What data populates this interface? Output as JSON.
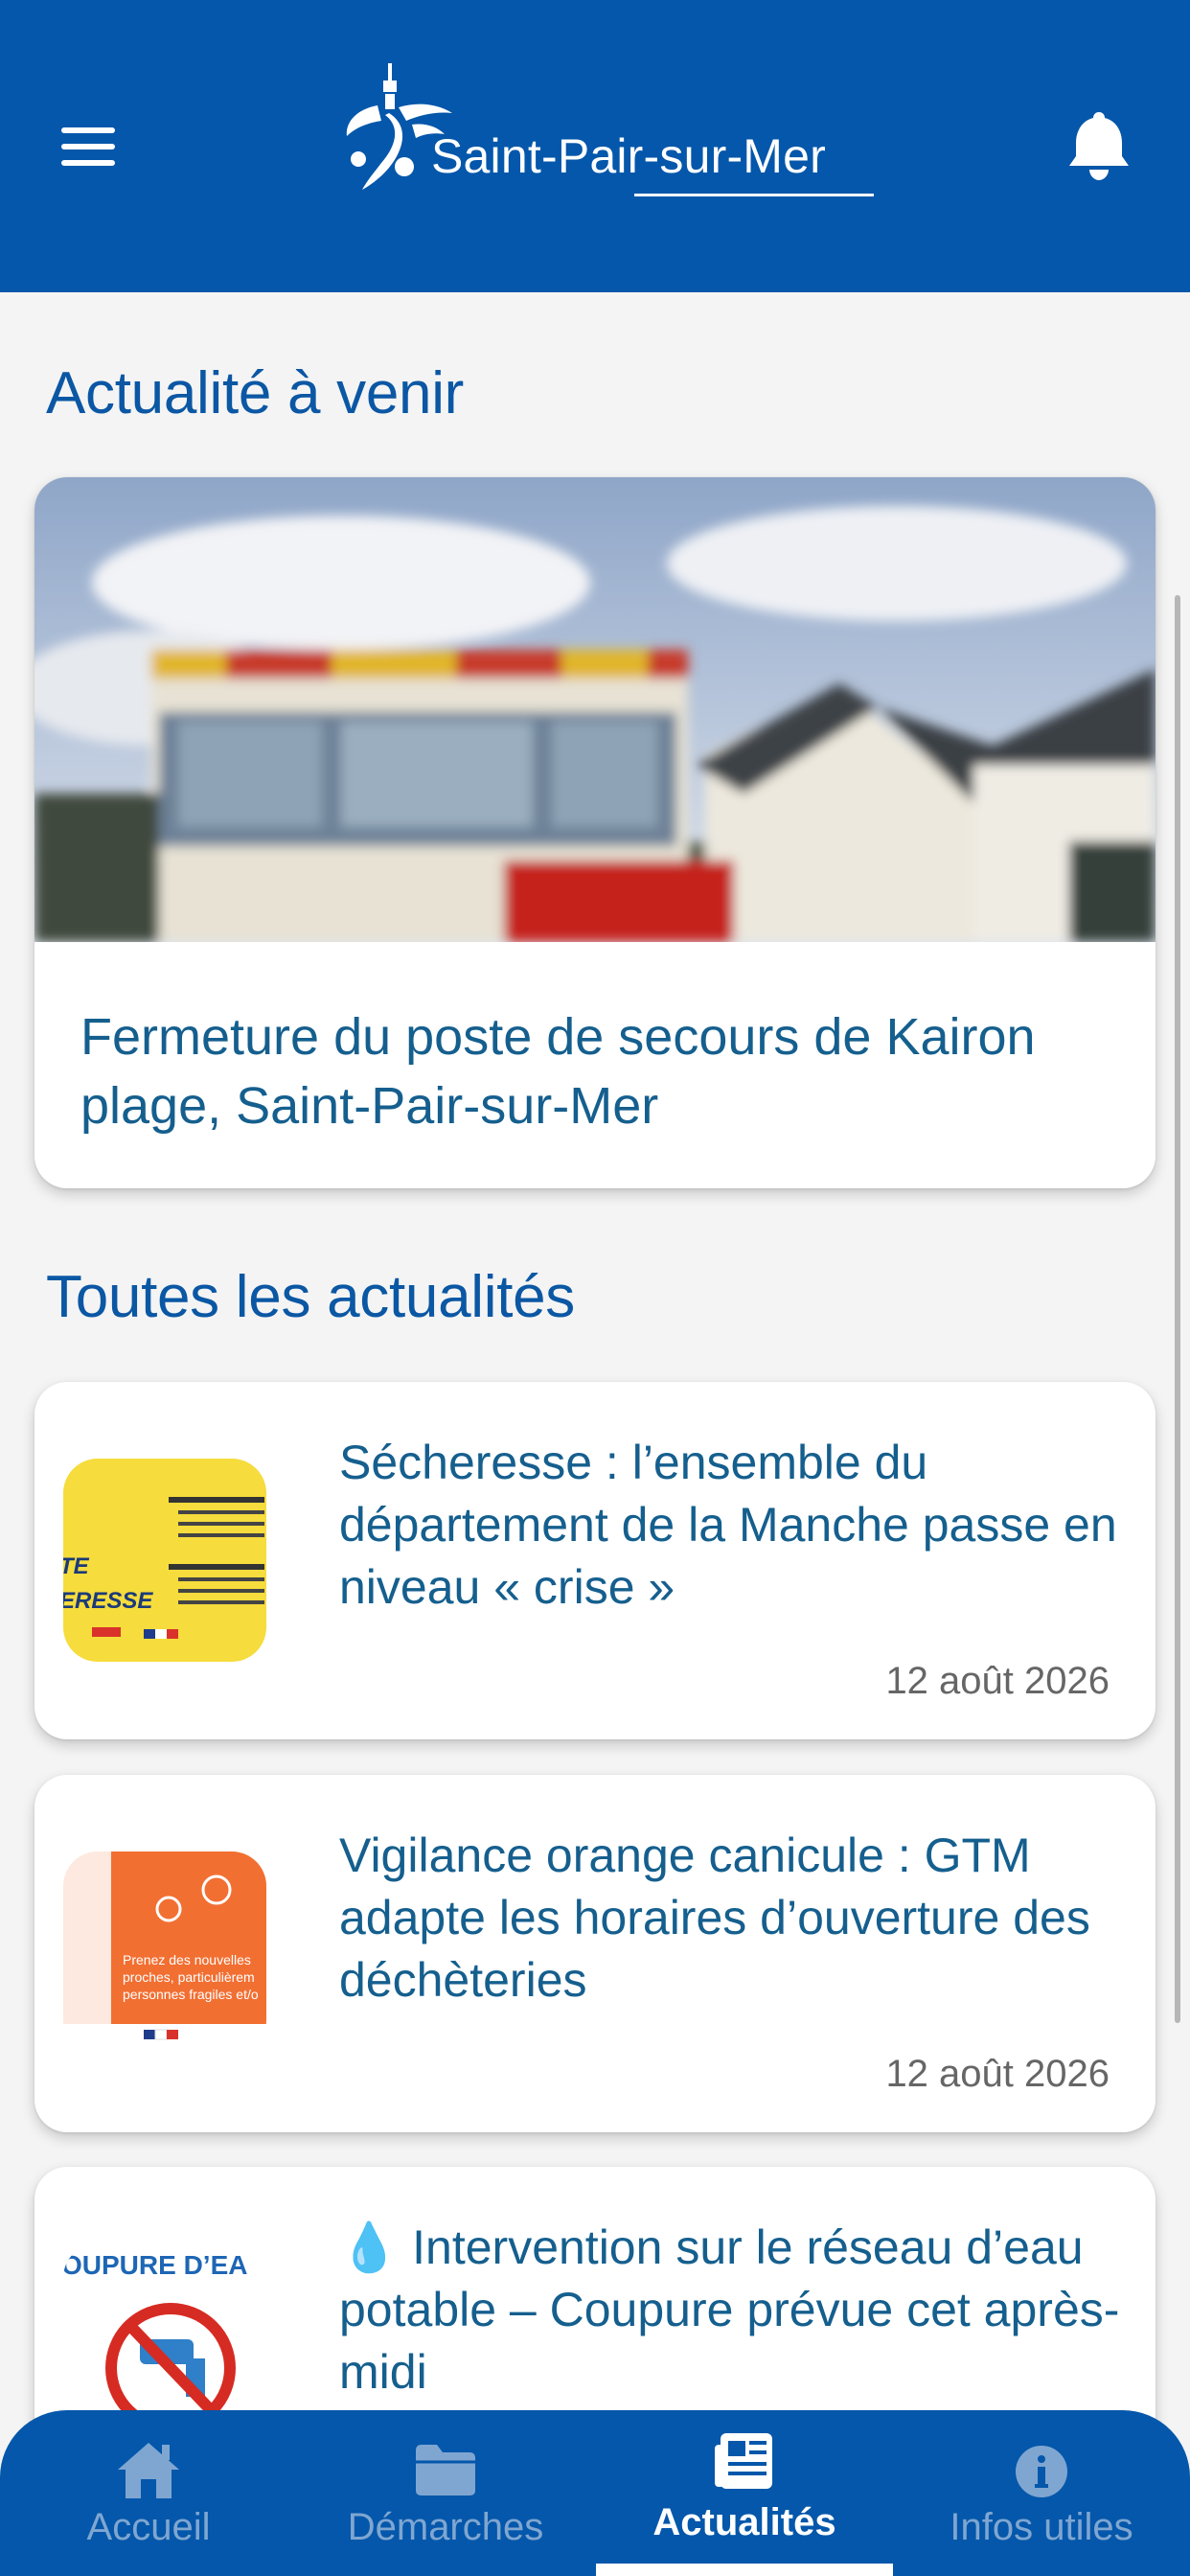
{
  "header": {
    "app_name": "Saint-Pair-sur-Mer",
    "menu_icon": "hamburger-menu-icon",
    "notification_icon": "bell-icon"
  },
  "upcoming": {
    "section_title": "Actualité à venir",
    "card_title": "Fermeture du poste de secours de Kairon plage, Saint-Pair-sur-Mer"
  },
  "all_news": {
    "section_title": "Toutes les actualités",
    "items": [
      {
        "title": "Sécheresse : l’ensemble du département de la Manche passe en niveau « crise »",
        "date": "12 août 2026",
        "thumb_lines": [
          "TE",
          "ERESSE"
        ]
      },
      {
        "title": "Vigilance orange canicule : GTM adapte les horaires d’ouverture des déchèteries",
        "date": "12 août 2026",
        "thumb_lines": [
          "Prenez des nouvelles",
          "proches, particulièrem",
          "personnes fragiles et/o"
        ]
      },
      {
        "title": "💧 Intervention sur le réseau d’eau potable – Coupure prévue cet après-midi",
        "thumb_lines": [
          "OUPURE D’EA"
        ]
      }
    ]
  },
  "bottom_nav": {
    "items": [
      {
        "label": "Accueil",
        "icon": "home-icon"
      },
      {
        "label": "Démarches",
        "icon": "folder-icon"
      },
      {
        "label": "Actualités",
        "icon": "newspaper-icon",
        "active": true
      },
      {
        "label": "Infos utiles",
        "icon": "info-icon"
      }
    ]
  },
  "colors": {
    "brand_blue": "#0457aa",
    "title_blue": "#0b57a4",
    "card_title": "#155f8e"
  }
}
